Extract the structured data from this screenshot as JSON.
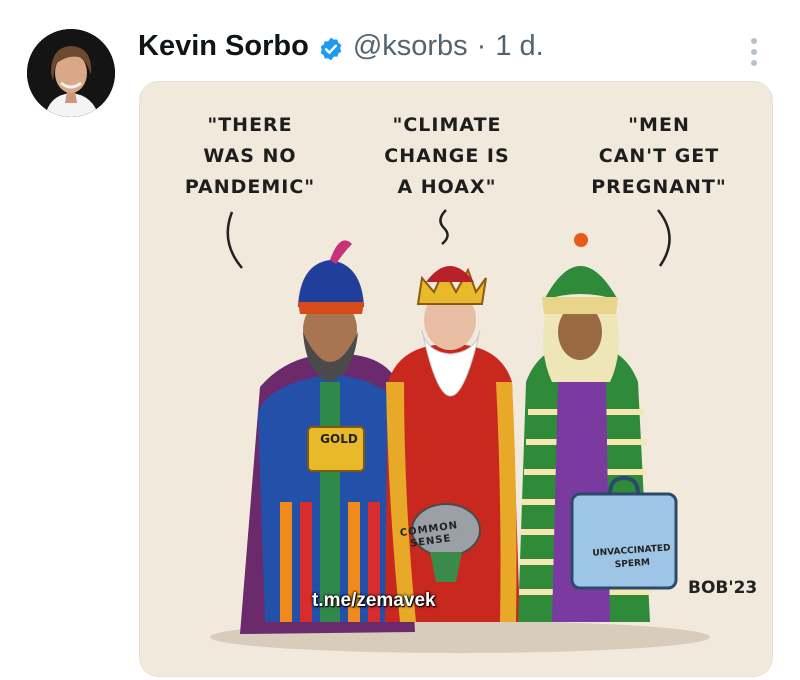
{
  "tweet": {
    "author_name": "Kevin Sorbo",
    "handle": "@ksorbs",
    "separator": "·",
    "time": "1 d.",
    "verified": true,
    "accent_color": "#1d9bf0"
  },
  "cartoon": {
    "quote_left": "\"THERE\nWAS NO\nPANDEMIC\"",
    "quote_middle": "\"CLIMATE\nCHANGE IS\nA HOAX\"",
    "quote_right": "\"MEN\nCAN'T GET\nPREGNANT\"",
    "gift_left_label": "GOLD",
    "gift_middle_label": "COMMON\nSENSE",
    "gift_right_label": "UNVACCINATED\nSPERM",
    "signature": "BOB'23",
    "watermark": "t.me/zemavek"
  },
  "icons": {
    "verified": "verified-badge-icon",
    "more": "more-vertical-icon"
  }
}
